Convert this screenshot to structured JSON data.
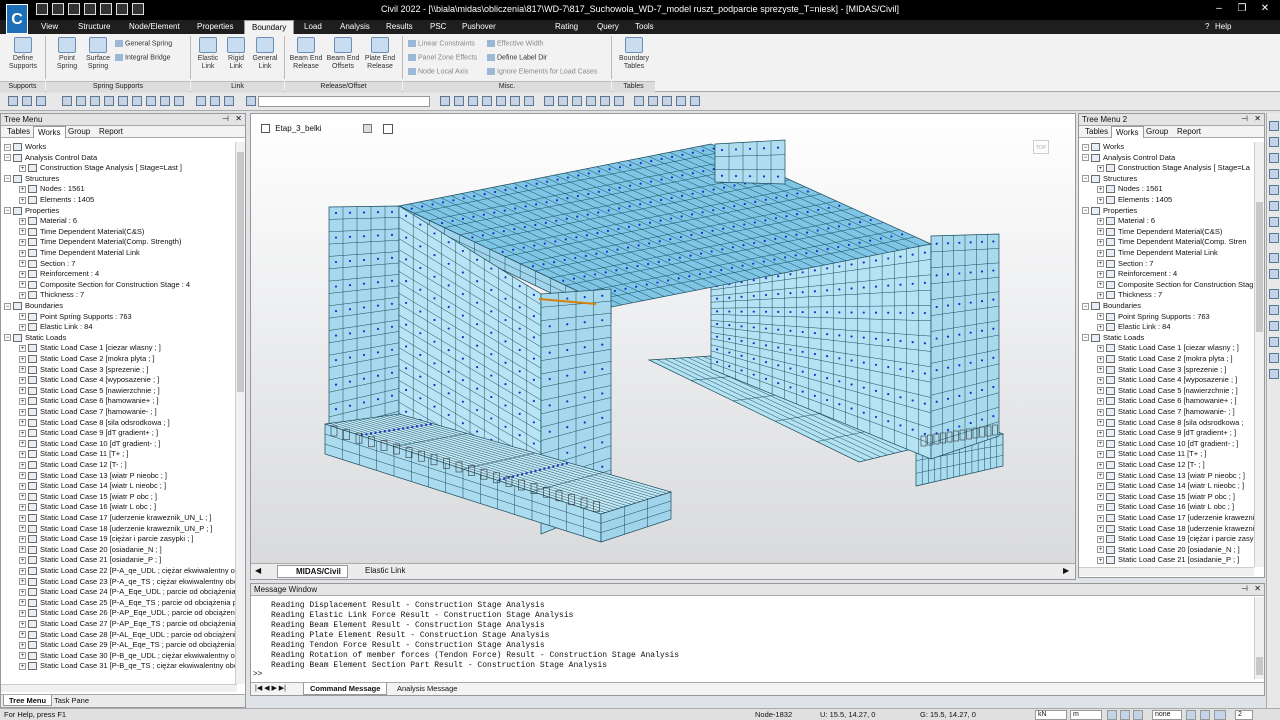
{
  "app": {
    "title": "Civil 2022 - [\\\\biala\\midas\\obliczenia\\817\\WD-7\\817_Suchowola_WD-7_model ruszt_podparcie sprezyste_T=niesk] - [MIDAS/Civil]",
    "logo": "C"
  },
  "menu": {
    "tabs": [
      "View",
      "Structure",
      "Node/Element",
      "Properties",
      "Boundary",
      "Load",
      "Analysis",
      "Results",
      "PSC",
      "Pushover",
      "Rating",
      "Query",
      "Tools"
    ],
    "active": "Boundary",
    "help": "Help"
  },
  "ribbon": {
    "define_supports": "Define Supports",
    "point_spring": "Point Spring",
    "surface_spring": "Surface Spring",
    "general_spring": "General Spring",
    "integral_bridge": "Integral Bridge",
    "elastic_link": "Elastic Link",
    "rigid_link": "Rigid Link",
    "general_link": "General Link",
    "beam_end_release": "Beam End Release",
    "beam_end_offsets": "Beam End Offsets",
    "plate_end_release": "Plate End Release",
    "linear_constraints": "Linear Constraints",
    "effective_width": "Effective Width",
    "panel_zone_effects": "Panel Zone Effects",
    "define_label_dir": "Define Label Dir",
    "node_local_axis": "Node Local Axis",
    "ignore_elements": "Ignore Elements for Load Cases",
    "boundary_tables": "Boundary Tables",
    "groups": [
      "Supports",
      "Spring Supports",
      "Link",
      "Release/Offset",
      "Misc.",
      "Tables"
    ]
  },
  "left_panel": {
    "title": "Tree Menu",
    "tabs": [
      "Tables",
      "Works",
      "Group",
      "Report"
    ],
    "active_tab": "Works",
    "items": [
      {
        "t": "Works",
        "lvl": 0
      },
      {
        "t": "Analysis Control Data",
        "lvl": 0
      },
      {
        "t": "Construction Stage Analysis [ Stage=Last ]",
        "lvl": 1
      },
      {
        "t": "Structures",
        "lvl": 0
      },
      {
        "t": "Nodes : 1561",
        "lvl": 1
      },
      {
        "t": "Elements : 1405",
        "lvl": 1
      },
      {
        "t": "Properties",
        "lvl": 0
      },
      {
        "t": "Material : 6",
        "lvl": 1
      },
      {
        "t": "Time Dependent Material(C&S)",
        "lvl": 1
      },
      {
        "t": "Time Dependent Material(Comp. Strength)",
        "lvl": 1
      },
      {
        "t": "Time Dependent Material Link",
        "lvl": 1
      },
      {
        "t": "Section : 7",
        "lvl": 1
      },
      {
        "t": "Reinforcement : 4",
        "lvl": 1
      },
      {
        "t": "Composite Section for Construction Stage : 4",
        "lvl": 1
      },
      {
        "t": "Thickness : 7",
        "lvl": 1
      },
      {
        "t": "Boundaries",
        "lvl": 0
      },
      {
        "t": "Point Spring Supports : 763",
        "lvl": 1
      },
      {
        "t": "Elastic Link : 84",
        "lvl": 1
      },
      {
        "t": "Static Loads",
        "lvl": 0
      },
      {
        "t": "Static Load Case 1 [ciezar wlasny ; ]",
        "lvl": 1
      },
      {
        "t": "Static Load Case 2 [mokra plyta ; ]",
        "lvl": 1
      },
      {
        "t": "Static Load Case 3 [sprezenie ; ]",
        "lvl": 1
      },
      {
        "t": "Static Load Case 4 [wyposazenie ; ]",
        "lvl": 1
      },
      {
        "t": "Static Load Case 5 [nawierzchnie ; ]",
        "lvl": 1
      },
      {
        "t": "Static Load Case 6 [hamowanie+ ; ]",
        "lvl": 1
      },
      {
        "t": "Static Load Case 7 [hamowanie- ; ]",
        "lvl": 1
      },
      {
        "t": "Static Load Case 8 [sila odsrodkowa ; ]",
        "lvl": 1
      },
      {
        "t": "Static Load Case 9 [dT gradient+ ; ]",
        "lvl": 1
      },
      {
        "t": "Static Load Case 10 [dT gradient- ; ]",
        "lvl": 1
      },
      {
        "t": "Static Load Case 11 [T+ ; ]",
        "lvl": 1
      },
      {
        "t": "Static Load Case 12 [T- ; ]",
        "lvl": 1
      },
      {
        "t": "Static Load Case 13 [wiatr P nieobc ; ]",
        "lvl": 1
      },
      {
        "t": "Static Load Case 14 [wiatr L nieobc ; ]",
        "lvl": 1
      },
      {
        "t": "Static Load Case 15 [wiatr P obc ; ]",
        "lvl": 1
      },
      {
        "t": "Static Load Case 16 [wiatr L obc ; ]",
        "lvl": 1
      },
      {
        "t": "Static Load Case 17 [uderzenie kraweznik_UN_L ; ]",
        "lvl": 1
      },
      {
        "t": "Static Load Case 18 [uderzenie kraweznik_UN_P ; ]",
        "lvl": 1
      },
      {
        "t": "Static Load Case 19 [ciężar i parcie zasypki ; ]",
        "lvl": 1
      },
      {
        "t": "Static Load Case 20 [osiadanie_N ; ]",
        "lvl": 1
      },
      {
        "t": "Static Load Case 21 [osiadanie_P ; ]",
        "lvl": 1
      },
      {
        "t": "Static Load Case 22 [P-A_qe_UDL ; ciężar ekwiwalentny ob",
        "lvl": 1
      },
      {
        "t": "Static Load Case 23 [P-A_qe_TS ; ciężar ekwiwalentny obc",
        "lvl": 1
      },
      {
        "t": "Static Load Case 24 [P-A_Eqe_UDL ; parcie od obciążenia",
        "lvl": 1
      },
      {
        "t": "Static Load Case 25 [P-A_Eqe_TS ; parcie od obciążenia p",
        "lvl": 1
      },
      {
        "t": "Static Load Case 26 [P-AP_Eqe_UDL ; parcie od obciążenia",
        "lvl": 1
      },
      {
        "t": "Static Load Case 27 [P-AP_Eqe_TS ; parcie od obciążenia (",
        "lvl": 1
      },
      {
        "t": "Static Load Case 28 [P-AL_Eqe_UDL ; parcie od obciążenia",
        "lvl": 1
      },
      {
        "t": "Static Load Case 29 [P-AL_Eqe_TS ; parcie od obciążenia p",
        "lvl": 1
      },
      {
        "t": "Static Load Case 30 [P-B_qe_UDL ; ciężar ekwiwalentny obc",
        "lvl": 1
      },
      {
        "t": "Static Load Case 31 [P-B_qe_TS ; ciężar ekwiwalentny obc",
        "lvl": 1
      }
    ],
    "bottom_tabs": [
      "Tree Menu",
      "Task Pane"
    ]
  },
  "right_panel": {
    "title": "Tree Menu 2",
    "tabs": [
      "Tables",
      "Works",
      "Group",
      "Report"
    ],
    "active_tab": "Works",
    "items": [
      {
        "t": "Works",
        "lvl": 0
      },
      {
        "t": "Analysis Control Data",
        "lvl": 0
      },
      {
        "t": "Construction Stage Analysis [ Stage=La",
        "lvl": 1
      },
      {
        "t": "Structures",
        "lvl": 0
      },
      {
        "t": "Nodes : 1561",
        "lvl": 1
      },
      {
        "t": "Elements : 1405",
        "lvl": 1
      },
      {
        "t": "Properties",
        "lvl": 0
      },
      {
        "t": "Material : 6",
        "lvl": 1
      },
      {
        "t": "Time Dependent Material(C&S)",
        "lvl": 1
      },
      {
        "t": "Time Dependent Material(Comp. Stren",
        "lvl": 1
      },
      {
        "t": "Time Dependent Material Link",
        "lvl": 1
      },
      {
        "t": "Section : 7",
        "lvl": 1
      },
      {
        "t": "Reinforcement : 4",
        "lvl": 1
      },
      {
        "t": "Composite Section for Construction Stag",
        "lvl": 1
      },
      {
        "t": "Thickness : 7",
        "lvl": 1
      },
      {
        "t": "Boundaries",
        "lvl": 0
      },
      {
        "t": "Point Spring Supports : 763",
        "lvl": 1
      },
      {
        "t": "Elastic Link : 84",
        "lvl": 1
      },
      {
        "t": "Static Loads",
        "lvl": 0
      },
      {
        "t": "Static Load Case 1 [ciezar wlasny ; ]",
        "lvl": 1
      },
      {
        "t": "Static Load Case 2 [mokra plyta ; ]",
        "lvl": 1
      },
      {
        "t": "Static Load Case 3 [sprezenie ; ]",
        "lvl": 1
      },
      {
        "t": "Static Load Case 4 [wyposazenie ; ]",
        "lvl": 1
      },
      {
        "t": "Static Load Case 5 [nawierzchnie ; ]",
        "lvl": 1
      },
      {
        "t": "Static Load Case 6 [hamowanie+ ; ]",
        "lvl": 1
      },
      {
        "t": "Static Load Case 7 [hamowanie- ; ]",
        "lvl": 1
      },
      {
        "t": "Static Load Case 8 [sila odsrodkowa ;",
        "lvl": 1
      },
      {
        "t": "Static Load Case 9 [dT gradient+ ; ]",
        "lvl": 1
      },
      {
        "t": "Static Load Case 10 [dT gradient- ; ]",
        "lvl": 1
      },
      {
        "t": "Static Load Case 11 [T+ ; ]",
        "lvl": 1
      },
      {
        "t": "Static Load Case 12 [T- ; ]",
        "lvl": 1
      },
      {
        "t": "Static Load Case 13 [wiatr P nieobc ; ]",
        "lvl": 1
      },
      {
        "t": "Static Load Case 14 [wiatr L nieobc ; ]",
        "lvl": 1
      },
      {
        "t": "Static Load Case 15 [wiatr P obc ; ]",
        "lvl": 1
      },
      {
        "t": "Static Load Case 16 [wiatr L obc ; ]",
        "lvl": 1
      },
      {
        "t": "Static Load Case 17 [uderzenie krawezni",
        "lvl": 1
      },
      {
        "t": "Static Load Case 18 [uderzenie krawezni",
        "lvl": 1
      },
      {
        "t": "Static Load Case 19 [ciężar i parcie zasy",
        "lvl": 1
      },
      {
        "t": "Static Load Case 20 [osiadanie_N ; ]",
        "lvl": 1
      },
      {
        "t": "Static Load Case 21 [osiadanie_P ; ]",
        "lvl": 1
      }
    ]
  },
  "view": {
    "stage": "Etap_3_belki",
    "tabs": [
      "MIDAS/Civil",
      "Elastic Link"
    ],
    "active_tab": "MIDAS/Civil",
    "cube_label": "TOP"
  },
  "message_window": {
    "title": "Message Window",
    "lines": [
      "Reading Displacement Result - Construction Stage Analysis",
      "Reading Elastic Link Force Result - Construction Stage Analysis",
      "Reading Beam Element Result - Construction Stage Analysis",
      "Reading Plate Element Result - Construction Stage Analysis",
      "Reading Tendon Force Result - Construction Stage Analysis",
      "Reading Rotation of member forces (Tendon Force) Result - Construction Stage Analysis",
      "Reading Beam Element Section Part Result - Construction Stage Analysis"
    ],
    "prompt": ">>",
    "tabs": [
      "Command Message",
      "Analysis Message"
    ]
  },
  "status": {
    "help": "For Help, press F1",
    "node": "Node-1832",
    "u": "U: 15.5, 14.27, 0",
    "g": "G: 15.5, 14.27, 0",
    "force_unit": "kN",
    "length_unit": "m",
    "mode": "none",
    "count": "2"
  },
  "colors": {
    "mesh_fill": "#b9e4f5",
    "mesh_line": "#1b4a5c",
    "node": "#1a2fd0",
    "accent": "#d4820a"
  }
}
